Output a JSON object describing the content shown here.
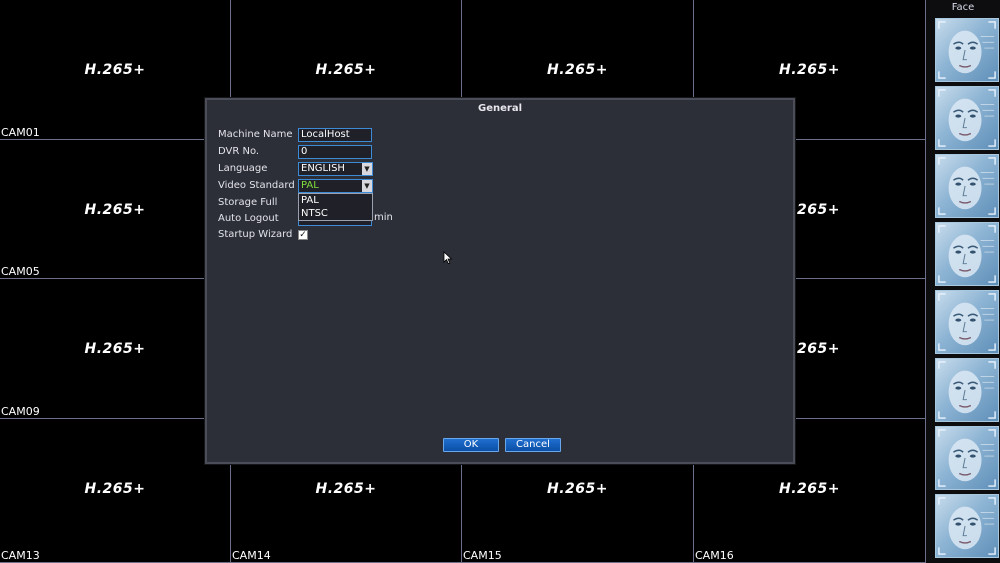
{
  "grid": {
    "codec_label": "H.265+",
    "cells": [
      {
        "cam": "CAM01"
      },
      {
        "cam": ""
      },
      {
        "cam": ""
      },
      {
        "cam": ""
      },
      {
        "cam": "CAM05"
      },
      {
        "cam": ""
      },
      {
        "cam": ""
      },
      {
        "cam": ""
      },
      {
        "cam": "CAM09"
      },
      {
        "cam": ""
      },
      {
        "cam": ""
      },
      {
        "cam": ""
      },
      {
        "cam": "CAM13"
      },
      {
        "cam": "CAM14"
      },
      {
        "cam": "CAM15"
      },
      {
        "cam": "CAM16"
      }
    ]
  },
  "face_panel": {
    "title": "Face",
    "thumb_count": 8
  },
  "dialog": {
    "title": "General",
    "machine_name": {
      "label": "Machine Name",
      "value": "LocalHost"
    },
    "dvr_no": {
      "label": "DVR No.",
      "value": "0"
    },
    "language": {
      "label": "Language",
      "value": "ENGLISH"
    },
    "video_standard": {
      "label": "Video Standard",
      "value": "PAL",
      "options": [
        "PAL",
        "NTSC"
      ]
    },
    "storage_full": {
      "label": "Storage Full"
    },
    "auto_logout": {
      "label": "Auto Logout",
      "unit": "min"
    },
    "startup_wizard": {
      "label": "Startup Wizard",
      "checked": true,
      "check_glyph": "✓"
    },
    "ok_label": "OK",
    "cancel_label": "Cancel"
  },
  "colors": {
    "dialog_bg": "#2c2e38",
    "field_border": "#3d8ad6",
    "selected_value": "#7fdc3c",
    "button_blue": "#0b4fa6"
  }
}
